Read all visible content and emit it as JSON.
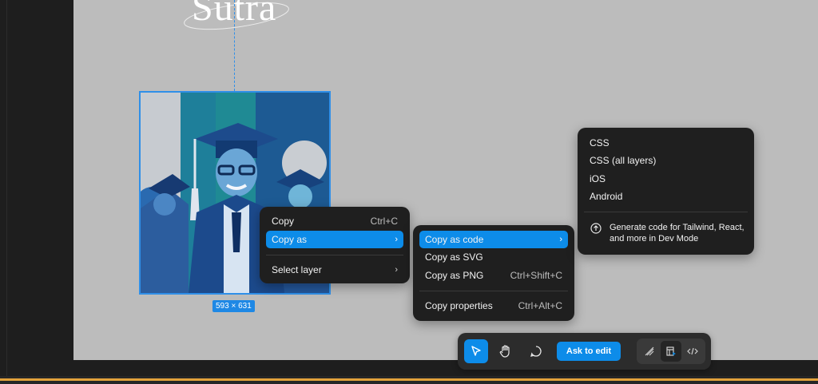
{
  "canvas": {
    "title_text": "Sutra",
    "image_size": "593 × 631"
  },
  "context_menu": {
    "items": [
      {
        "label": "Copy",
        "shortcut": "Ctrl+C"
      },
      {
        "label": "Copy as",
        "chevron": "›"
      },
      {
        "label": "Select layer",
        "chevron": "›"
      }
    ]
  },
  "copy_as_menu": {
    "items": [
      {
        "label": "Copy as code",
        "chevron": "›"
      },
      {
        "label": "Copy as SVG"
      },
      {
        "label": "Copy as PNG",
        "shortcut": "Ctrl+Shift+C"
      },
      {
        "label": "Copy properties",
        "shortcut": "Ctrl+Alt+C"
      }
    ]
  },
  "code_menu": {
    "items": [
      {
        "label": "CSS"
      },
      {
        "label": "CSS (all layers)"
      },
      {
        "label": "iOS"
      },
      {
        "label": "Android"
      }
    ],
    "dev_mode_text": "Generate code for Tailwind, React, and more in Dev Mode"
  },
  "toolbar": {
    "ask_to_edit": "Ask to edit",
    "tools": [
      "move-tool-icon",
      "hand-tool-icon",
      "comment-icon"
    ],
    "modes": [
      "draw-mode-icon",
      "design-mode-icon",
      "dev-mode-icon"
    ]
  },
  "colors": {
    "accent": "#0d8ce9",
    "canvas": "#bcbcbc",
    "menu_bg": "#1f1f1f",
    "bottom_accent": "#e2a23b"
  }
}
